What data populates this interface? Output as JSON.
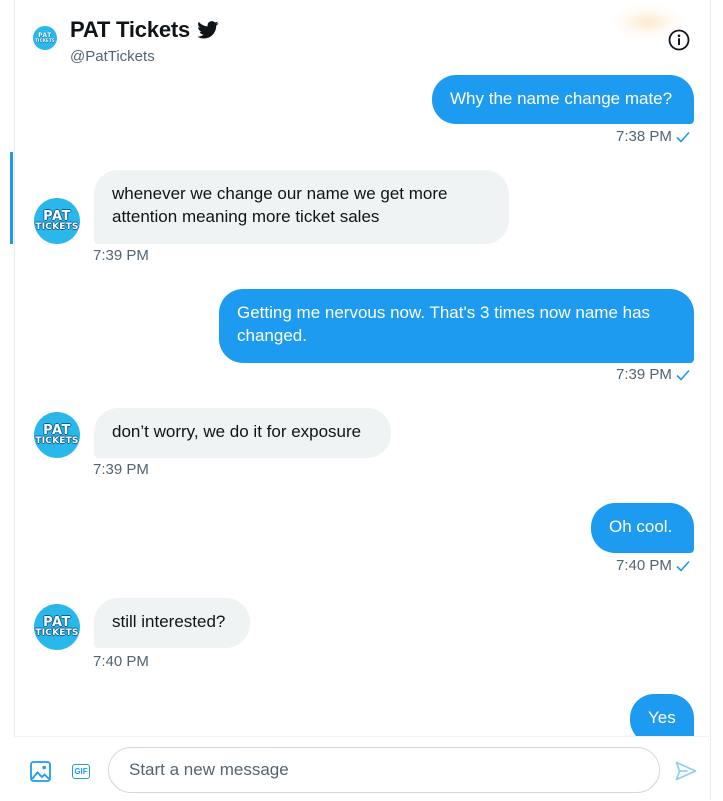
{
  "header": {
    "name": "PAT Tickets",
    "handle": "@PatTickets",
    "avatar_line1": "PAT",
    "avatar_line2": "TICKETS"
  },
  "messages": [
    {
      "direction": "sent",
      "text": "Why the name change mate?",
      "time": "7:38 PM"
    },
    {
      "direction": "received",
      "text": "whenever we change our name we get more attention meaning more ticket sales",
      "time": "7:39 PM"
    },
    {
      "direction": "sent",
      "text": "Getting me nervous now. That's 3 times now name has changed.",
      "time": "7:39 PM"
    },
    {
      "direction": "received",
      "text": "don’t worry, we do it for exposure",
      "time": "7:39 PM"
    },
    {
      "direction": "sent",
      "text": "Oh cool.",
      "time": "7:40 PM"
    },
    {
      "direction": "received",
      "text": "still interested?",
      "time": "7:40 PM"
    },
    {
      "direction": "sent",
      "text": "Yes",
      "time": ""
    }
  ],
  "composer": {
    "placeholder": "Start a new message",
    "gif_label": "GIF"
  },
  "colors": {
    "accent": "#1d9bf0",
    "received_bubble": "#eff3f4",
    "avatar": "#2ab7ea"
  },
  "icons": [
    "twitter-bird-icon",
    "info-icon",
    "image-icon",
    "gif-icon",
    "send-icon",
    "checkmark-icon"
  ]
}
